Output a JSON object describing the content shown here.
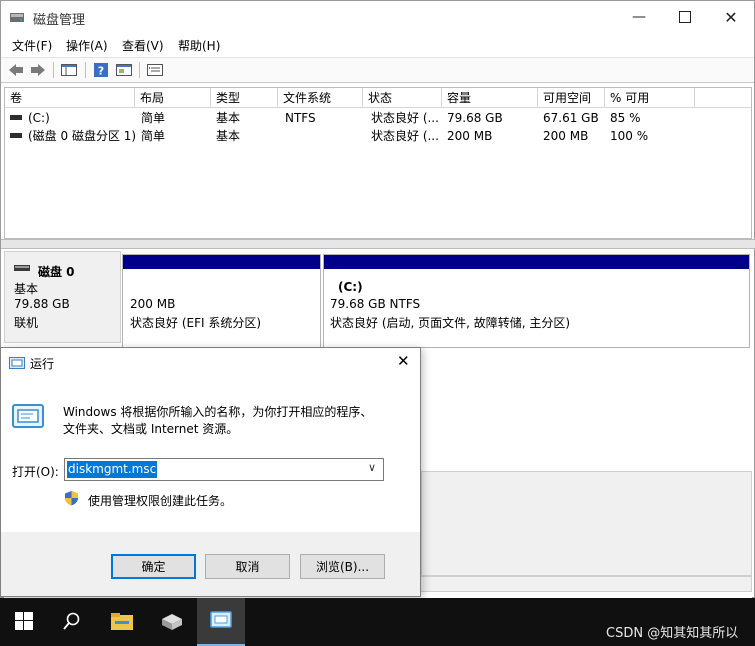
{
  "window": {
    "title": "磁盘管理",
    "controls": [
      "minimize",
      "maximize",
      "close"
    ]
  },
  "menu": [
    "文件(F)",
    "操作(A)",
    "查看(V)",
    "帮助(H)"
  ],
  "toolbar_icons": [
    "back-arrow-icon",
    "forward-arrow-icon",
    "console-tree-icon",
    "help-icon",
    "properties-icon",
    "list-view-icon"
  ],
  "volume_table": {
    "columns": [
      "卷",
      "布局",
      "类型",
      "文件系统",
      "状态",
      "容量",
      "可用空间",
      "% 可用"
    ],
    "rows": [
      [
        "(C:)",
        "简单",
        "基本",
        "NTFS",
        "状态良好 (...",
        "79.68 GB",
        "67.61 GB",
        "85 %"
      ],
      [
        "(磁盘 0 磁盘分区 1)",
        "简单",
        "基本",
        "",
        "状态良好 (...",
        "200 MB",
        "200 MB",
        "100 %"
      ]
    ]
  },
  "disk_map": {
    "disk": {
      "name": "磁盘 0",
      "type": "基本",
      "size": "79.88 GB",
      "status": "联机"
    },
    "partitions": [
      {
        "label": "",
        "size": "200 MB",
        "status": "状态良好 (EFI 系统分区)"
      },
      {
        "label": "(C:)",
        "size": "79.68 GB NTFS",
        "status": "状态良好 (启动, 页面文件, 故障转储, 主分区)"
      }
    ],
    "partition_header_color": "#00008b"
  },
  "run_dialog": {
    "title": "运行",
    "description": [
      "Windows 将根据你所输入的名称，为你打开相应的程序、",
      "文件夹、文档或 Internet 资源。"
    ],
    "open_label": "打开(O):",
    "open_value": "diskmgmt.msc",
    "admin_note": "使用管理权限创建此任务。",
    "buttons": {
      "ok": "确定",
      "cancel": "取消",
      "browse": "浏览(B)..."
    }
  },
  "taskbar": {
    "items": [
      "start-icon",
      "search-icon",
      "file-explorer-icon",
      "server-manager-icon",
      "run-icon"
    ],
    "watermark": "CSDN @知其知其所以"
  },
  "colors": {
    "accent": "#0078d7",
    "taskbar": "#101010",
    "partition_bar": "#00008b"
  }
}
